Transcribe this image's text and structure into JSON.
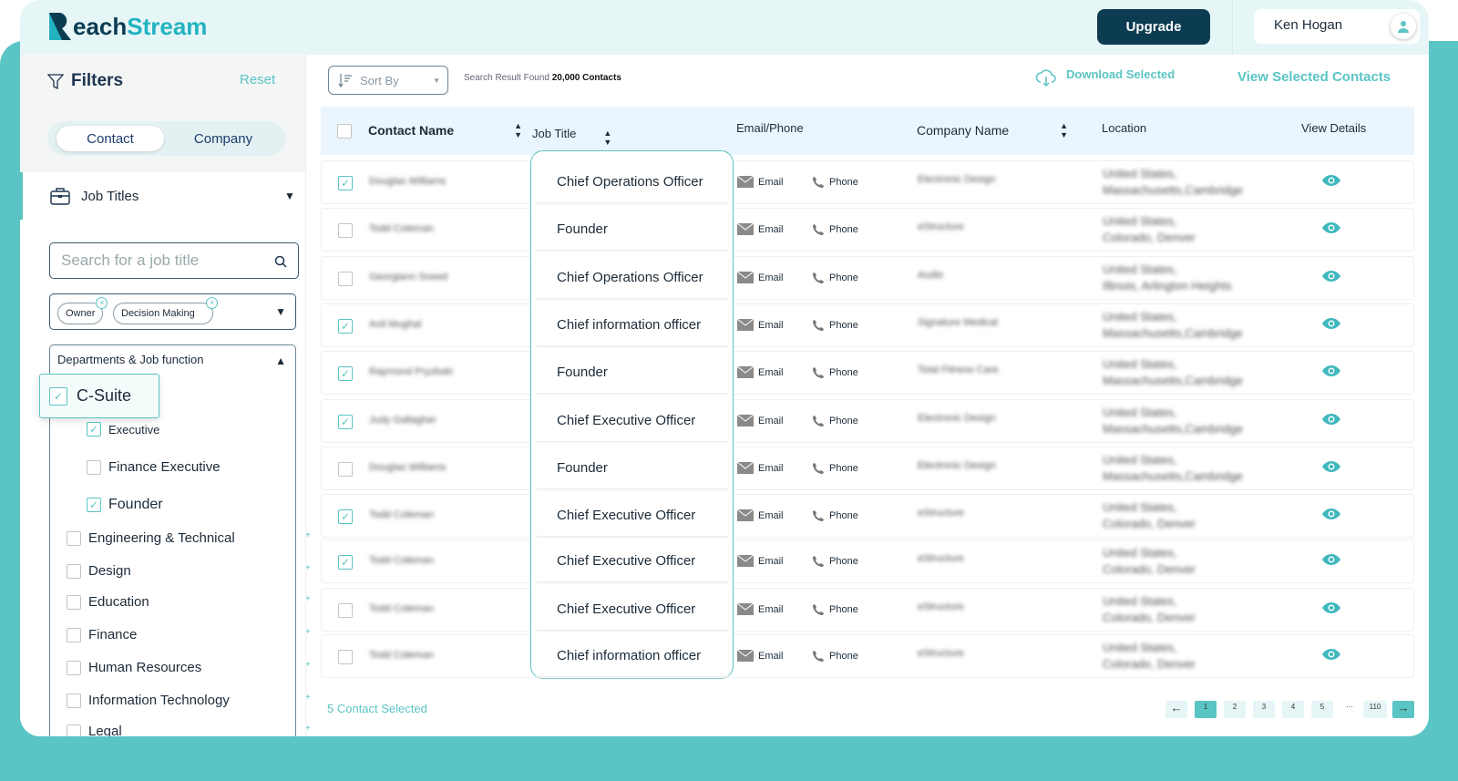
{
  "brand": {
    "name_a": "each",
    "name_b": "Stream",
    "accent": "#5bc4c4",
    "dark": "#0b3c52"
  },
  "header": {
    "upgrade": "Upgrade",
    "user": "Ken Hogan"
  },
  "sidebar": {
    "title": "Filters",
    "reset": "Reset",
    "tabs": [
      "Contact",
      "Company"
    ],
    "job_titles": "Job Titles",
    "search_placeholder": "Search for a job title",
    "chips": [
      "Owner",
      "Decision Making"
    ],
    "dept_label": "Departments & Job function",
    "csuite": "C-Suite",
    "sub": [
      {
        "label": "Executive",
        "checked": true
      },
      {
        "label": "Finance Executive",
        "checked": false
      },
      {
        "label": "Founder",
        "checked": true
      }
    ],
    "depts": [
      "Engineering & Technical",
      "Design",
      "Education",
      "Finance",
      "Human Resources",
      "Information Technology",
      "Legal"
    ]
  },
  "toolbar": {
    "sort": "Sort By",
    "found_prefix": "Search Result Found",
    "found_count": "20,000 Contacts",
    "download": "Download Selected",
    "view_selected": "View Selected Contacts"
  },
  "table": {
    "headers": [
      "Contact Name",
      "Job Title",
      "Email/Phone",
      "Company Name",
      "Location",
      "View Details"
    ],
    "email": "Email",
    "phone": "Phone",
    "rows": [
      {
        "checked": true,
        "name": "Douglas Williams",
        "title": "Chief Operations Officer",
        "company": "Electronic Design",
        "loc1": "United States,",
        "loc2": "Massachusetts,Cambridge"
      },
      {
        "checked": false,
        "name": "Todd Coleman",
        "title": "Founder",
        "company": "eStructure",
        "loc1": "United States,",
        "loc2": "Colorado, Denver"
      },
      {
        "checked": false,
        "name": "Georgiann Sneed",
        "title": "Chief Operations Officer",
        "company": "Audio",
        "loc1": "United States,",
        "loc2": "Illinois, Arlington Heights"
      },
      {
        "checked": true,
        "name": "Anil Mughal",
        "title": "Chief information officer",
        "company": "Signature Medical",
        "loc1": "United States,",
        "loc2": "Massachusetts,Cambridge"
      },
      {
        "checked": true,
        "name": "Raymond Pryzbski",
        "title": "Founder",
        "company": "Total Fitness Care",
        "loc1": "United States,",
        "loc2": "Massachusetts,Cambridge"
      },
      {
        "checked": true,
        "name": "Judy Gallagher",
        "title": "Chief Executive Officer",
        "company": "Electronic Design",
        "loc1": "United States,",
        "loc2": "Massachusetts,Cambridge"
      },
      {
        "checked": false,
        "name": "Douglas Williams",
        "title": "Founder",
        "company": "Electronic Design",
        "loc1": "United States,",
        "loc2": "Massachusetts,Cambridge"
      },
      {
        "checked": true,
        "name": "Todd Coleman",
        "title": "Chief Executive Officer",
        "company": "eStructure",
        "loc1": "United States,",
        "loc2": "Colorado, Denver"
      },
      {
        "checked": true,
        "name": "Todd Coleman",
        "title": "Chief Executive Officer",
        "company": "eStructure",
        "loc1": "United States,",
        "loc2": "Colorado, Denver"
      },
      {
        "checked": false,
        "name": "Todd Coleman",
        "title": "Chief Executive Officer",
        "company": "eStructure",
        "loc1": "United States,",
        "loc2": "Colorado, Denver"
      },
      {
        "checked": false,
        "name": "Todd Coleman",
        "title": "Chief information officer",
        "company": "eStructure",
        "loc1": "United States,",
        "loc2": "Colorado, Denver"
      }
    ]
  },
  "footer": {
    "selected": "5 Contact Selected",
    "pages": [
      "1",
      "2",
      "3",
      "4",
      "5",
      "···",
      "110"
    ],
    "current_page": "1"
  }
}
